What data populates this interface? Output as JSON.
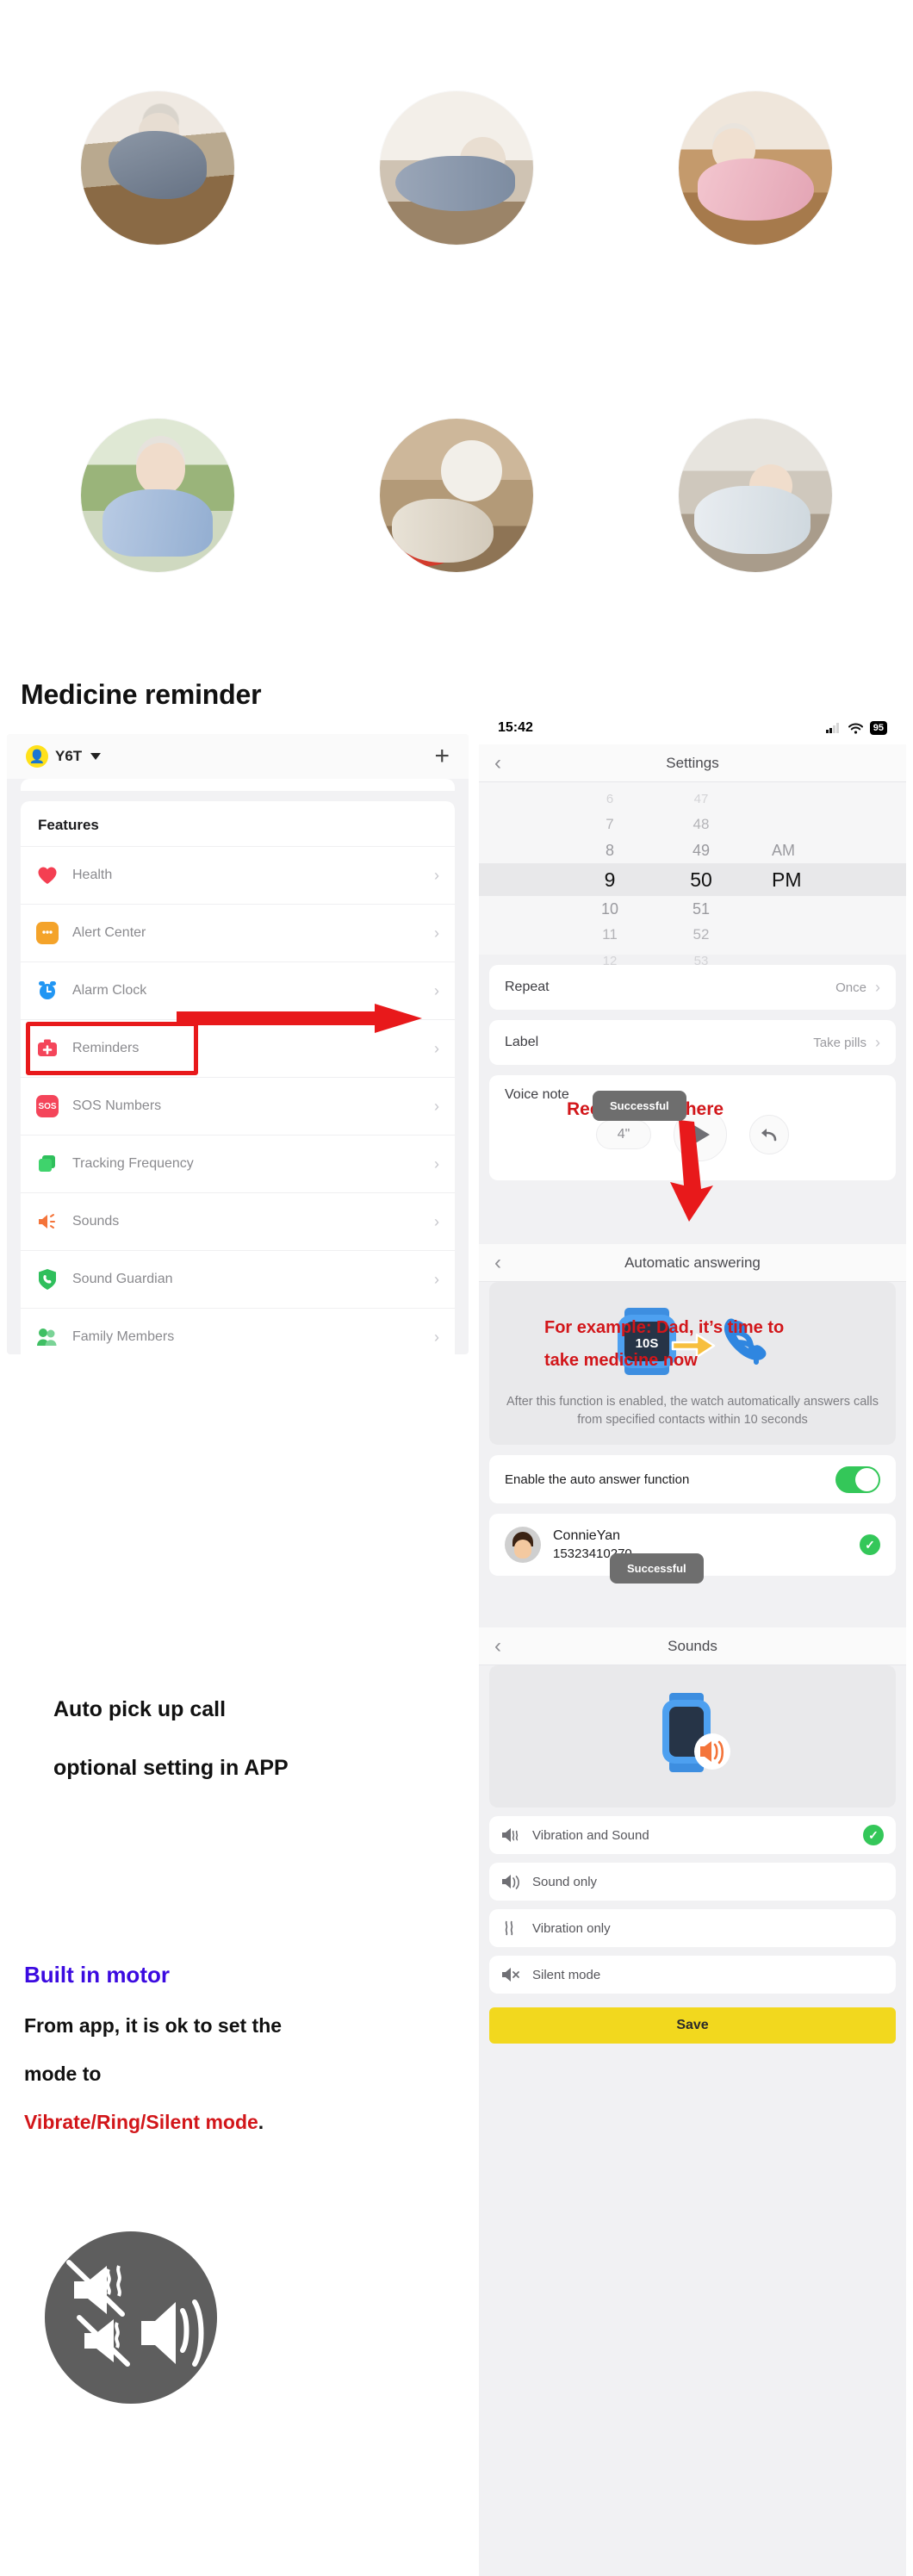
{
  "photos": [
    {
      "alt": "elderly-man-fallen-hallway"
    },
    {
      "alt": "elderly-man-fallen-floor"
    },
    {
      "alt": "elderly-woman-fallen-floor"
    },
    {
      "alt": "elderly-man-chest-pain-outdoors"
    },
    {
      "alt": "elderly-woman-fallen-with-cane"
    },
    {
      "alt": "elderly-woman-lying-on-rug"
    }
  ],
  "headings": {
    "medicine_reminder": "Medicine reminder"
  },
  "left_phone": {
    "device_name": "Y6T",
    "add_button": "+",
    "card_title": "Features",
    "features": [
      {
        "label": "Health",
        "icon": "heart-icon",
        "color": "#f43f52"
      },
      {
        "label": "Alert Center",
        "icon": "chat-bubble-icon",
        "color": "#f4a32a"
      },
      {
        "label": "Alarm Clock",
        "icon": "alarm-clock-icon",
        "color": "#2196f3"
      },
      {
        "label": "Reminders",
        "icon": "medical-kit-icon",
        "color": "#f4455a",
        "highlighted": true
      },
      {
        "label": "SOS Numbers",
        "icon": "sos-icon",
        "color": "#f4455a"
      },
      {
        "label": "Tracking Frequency",
        "icon": "layers-icon",
        "color": "#2fbf5c"
      },
      {
        "label": "Sounds",
        "icon": "speaker-icon",
        "color": "#f4743a"
      },
      {
        "label": "Sound Guardian",
        "icon": "shield-phone-icon",
        "color": "#2fbf5c"
      },
      {
        "label": "Family Members",
        "icon": "people-icon",
        "color": "#3fbf63"
      }
    ]
  },
  "right_phone": {
    "status_bar": {
      "time": "15:42",
      "battery": "95"
    },
    "settings_screen": {
      "title": "Settings",
      "back": "‹",
      "picker": {
        "hours": [
          "6",
          "7",
          "8",
          "9",
          "10",
          "11",
          "12"
        ],
        "minutes": [
          "47",
          "48",
          "49",
          "50",
          "51",
          "52",
          "53"
        ],
        "meridiem_above": "AM",
        "meridiem_selected": "PM",
        "selected_hour": "9",
        "selected_minute": "50"
      },
      "rows": [
        {
          "label": "Repeat",
          "value": "Once"
        },
        {
          "label": "Label",
          "value": "Take pills"
        }
      ],
      "voice_note": {
        "label": "Voice note",
        "duration": "4\"",
        "toast": "Successful",
        "play_icon": "play-icon",
        "redo_icon": "undo-icon"
      }
    },
    "auto_answer_screen": {
      "title": "Automatic answering",
      "hero_badge": "10S",
      "description": "After this function is enabled, the watch automatically answers calls from specified contacts within 10 seconds",
      "toggle_label": "Enable the auto answer function",
      "toggle_on": true,
      "contact": {
        "name": "ConnieYan",
        "phone": "15323410270",
        "selected": true
      },
      "toast": "Successful"
    },
    "sounds_screen": {
      "title": "Sounds",
      "options": [
        {
          "label": "Vibration and Sound",
          "icon": "speaker-vibrate-icon",
          "selected": true
        },
        {
          "label": "Sound only",
          "icon": "speaker-waves-icon",
          "selected": false
        },
        {
          "label": "Vibration only",
          "icon": "vibrate-icon",
          "selected": false
        },
        {
          "label": "Silent mode",
          "icon": "speaker-mute-icon",
          "selected": false
        }
      ],
      "save_label": "Save"
    }
  },
  "annotations": {
    "record_voice_here": "Record voice here",
    "example_line1": "For example: Dad, it’s time to",
    "example_line2": "take medicine now",
    "auto_pickup_line1": "Auto pick up call",
    "auto_pickup_line2": "optional setting in APP",
    "built_in_motor": "Built in motor",
    "motor_line1": "From app, it is ok to set the",
    "motor_line2": "mode to",
    "motor_line3_red": "Vibrate/Ring/Silent mode",
    "motor_line3_black": "."
  },
  "colors": {
    "red_accent": "#d2161a",
    "purple_accent": "#3b0ae0",
    "green": "#34c759",
    "yellow": "#f2d81e"
  }
}
